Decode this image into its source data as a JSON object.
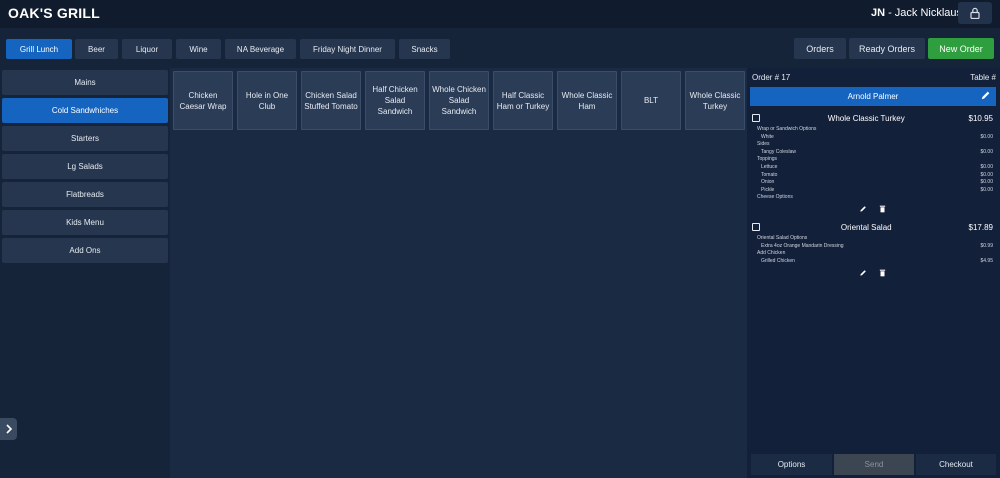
{
  "header": {
    "brand": "OAK'S GRILL",
    "user_initials": "JN",
    "user_name": "- Jack Nicklaus"
  },
  "categories": [
    "Grill Lunch",
    "Beer",
    "Liquor",
    "Wine",
    "NA Beverage",
    "Friday Night Dinner",
    "Snacks"
  ],
  "active_category": "Grill Lunch",
  "actions": {
    "orders": "Orders",
    "ready_orders": "Ready Orders",
    "new_order": "New Order"
  },
  "subcategories": [
    "Mains",
    "Cold Sandwhiches",
    "Starters",
    "Lg Salads",
    "Flatbreads",
    "Kids Menu",
    "Add Ons"
  ],
  "active_subcategory": "Cold Sandwhiches",
  "menu_items": [
    "Chicken Caesar Wrap",
    "Hole in One Club",
    "Chicken Salad Stuffed Tomato",
    "Half Chicken Salad Sandwich",
    "Whole Chicken Salad Sandwich",
    "Half Classic Ham or Turkey",
    "Whole Classic Ham",
    "BLT",
    "Whole Classic Turkey"
  ],
  "order": {
    "number_label": "Order # 17",
    "table_label": "Table #",
    "customer": "Arnold Palmer",
    "lines": [
      {
        "name": "Whole Classic Turkey",
        "price": "$10.95",
        "mods": [
          {
            "kind": "group",
            "label": "Wrap or Sandwich Options",
            "price": ""
          },
          {
            "kind": "opt",
            "label": "White",
            "price": "$0.00"
          },
          {
            "kind": "group",
            "label": "Sides",
            "price": ""
          },
          {
            "kind": "opt",
            "label": "Tangy Coleslaw",
            "price": "$0.00"
          },
          {
            "kind": "group",
            "label": "Toppings",
            "price": ""
          },
          {
            "kind": "opt",
            "label": "Lettuce",
            "price": "$0.00"
          },
          {
            "kind": "opt",
            "label": "Tomato",
            "price": "$0.00"
          },
          {
            "kind": "opt",
            "label": "Onion",
            "price": "$0.00"
          },
          {
            "kind": "opt",
            "label": "Pickle",
            "price": "$0.00"
          },
          {
            "kind": "group",
            "label": "Cheese Options",
            "price": ""
          }
        ]
      },
      {
        "name": "Oriental Salad",
        "price": "$17.89",
        "mods": [
          {
            "kind": "group",
            "label": "Oriental Salad Options",
            "price": ""
          },
          {
            "kind": "opt",
            "label": "Extra 4oz Orange Mandarin Dressing",
            "price": "$0.99"
          },
          {
            "kind": "group",
            "label": "Add Chicken",
            "price": ""
          },
          {
            "kind": "opt",
            "label": "Grilled Chicken",
            "price": "$4.95"
          }
        ]
      }
    ]
  },
  "footer": {
    "options": "Options",
    "send": "Send",
    "checkout": "Checkout"
  },
  "colors": {
    "accent": "#1565c0",
    "new_order": "#2e9e3e",
    "background": "#16243a"
  }
}
